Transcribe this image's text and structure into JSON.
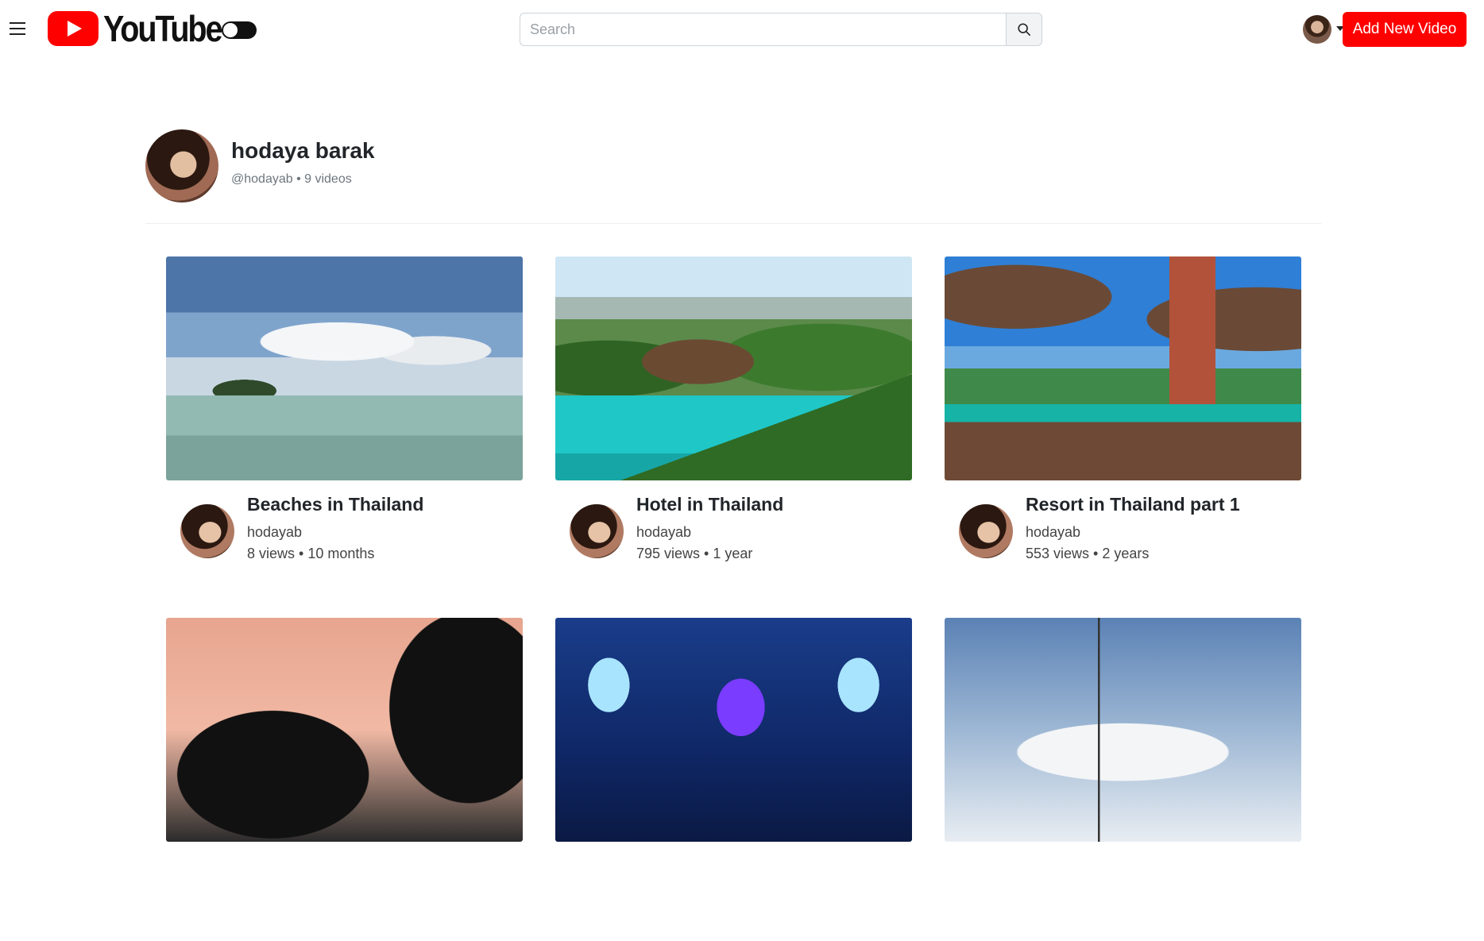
{
  "header": {
    "logo_text": "YouTube",
    "search_placeholder": "Search",
    "add_button_label": "Add New Video"
  },
  "channel": {
    "name": "hodaya barak",
    "meta": "@hodayab • 9 videos"
  },
  "videos": [
    {
      "title": "Beaches in Thailand",
      "channel": "hodayab",
      "stats": "8 views • 10 months"
    },
    {
      "title": "Hotel in Thailand",
      "channel": "hodayab",
      "stats": "795 views • 1 year"
    },
    {
      "title": "Resort in Thailand part 1",
      "channel": "hodayab",
      "stats": "553 views • 2 years"
    },
    {
      "title": "",
      "channel": "",
      "stats": ""
    },
    {
      "title": "",
      "channel": "",
      "stats": ""
    },
    {
      "title": "",
      "channel": "",
      "stats": ""
    }
  ],
  "colors": {
    "brand": "#ff0000",
    "text": "#212529",
    "muted": "#6c757d"
  },
  "icons": [
    "menu-icon",
    "youtube-logo-icon",
    "search-icon",
    "caret-down-icon"
  ]
}
